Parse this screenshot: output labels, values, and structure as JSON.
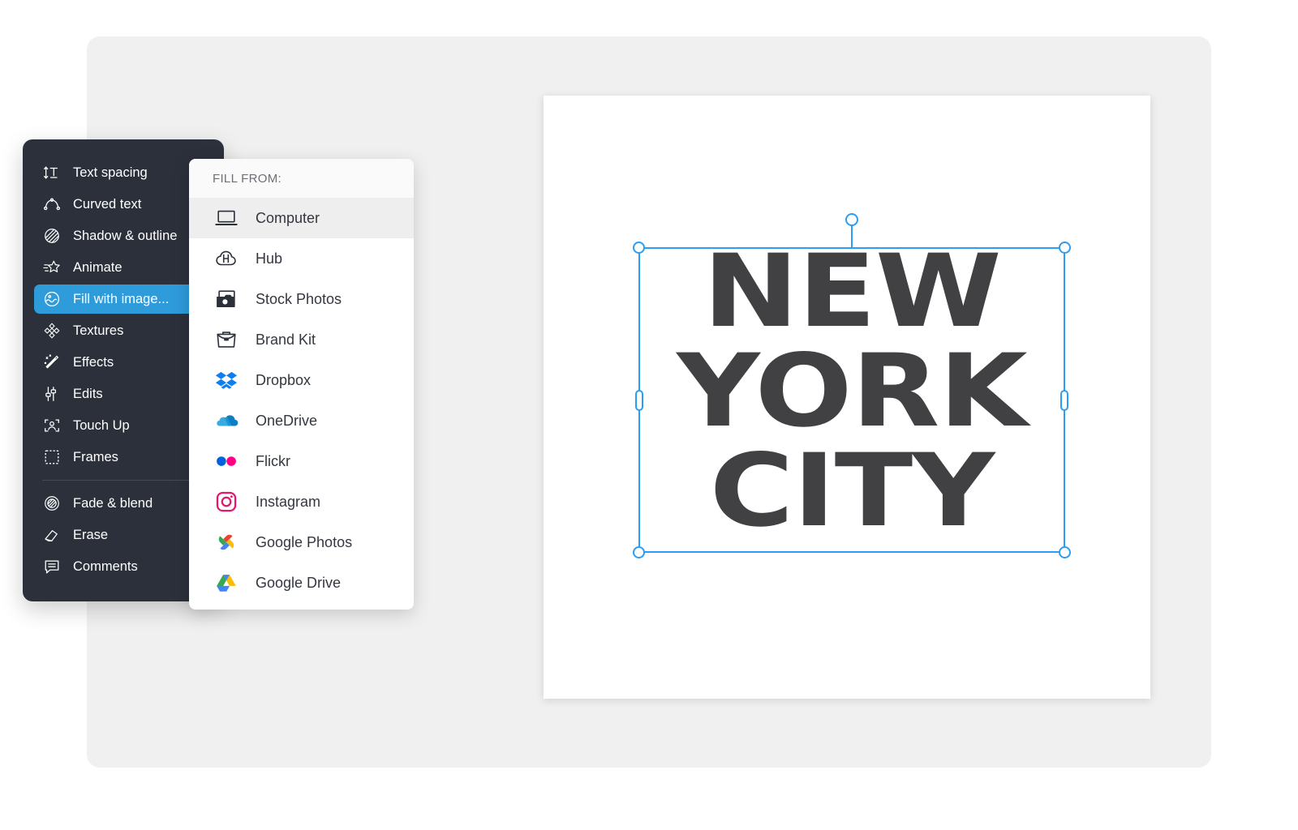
{
  "canvas": {
    "artwork_lines": [
      "NEW",
      "YORK",
      "CITY"
    ],
    "artwork_color": "#414042",
    "selection_color": "#2a9df4"
  },
  "tool_menu": {
    "items": [
      {
        "label": "Text spacing",
        "icon": "text-spacing-icon",
        "active": false
      },
      {
        "label": "Curved text",
        "icon": "curved-text-icon",
        "active": false
      },
      {
        "label": "Shadow & outline",
        "icon": "shadow-outline-icon",
        "active": false
      },
      {
        "label": "Animate",
        "icon": "animate-star-icon",
        "active": false
      },
      {
        "label": "Fill with image...",
        "icon": "fill-with-image-icon",
        "active": true
      },
      {
        "label": "Textures",
        "icon": "textures-icon",
        "active": false
      },
      {
        "label": "Effects",
        "icon": "effects-wand-icon",
        "active": false
      },
      {
        "label": "Edits",
        "icon": "edits-sliders-icon",
        "active": false
      },
      {
        "label": "Touch Up",
        "icon": "touch-up-face-icon",
        "active": false
      },
      {
        "label": "Frames",
        "icon": "frames-icon",
        "active": false
      },
      {
        "label": "Fade & blend",
        "icon": "fade-blend-icon",
        "active": false
      },
      {
        "label": "Erase",
        "icon": "erase-icon",
        "active": false
      },
      {
        "label": "Comments",
        "icon": "comments-icon",
        "active": false
      }
    ],
    "divider_after_index": 9,
    "background_color": "#2b303b",
    "active_color": "#2e9bda"
  },
  "fill_panel": {
    "header": "FILL FROM:",
    "items": [
      {
        "label": "Computer",
        "icon": "laptop-icon",
        "selected": true
      },
      {
        "label": "Hub",
        "icon": "hub-cloud-icon",
        "selected": false
      },
      {
        "label": "Stock Photos",
        "icon": "stock-photos-icon",
        "selected": false
      },
      {
        "label": "Brand Kit",
        "icon": "briefcase-icon",
        "selected": false
      },
      {
        "label": "Dropbox",
        "icon": "dropbox-icon",
        "selected": false
      },
      {
        "label": "OneDrive",
        "icon": "onedrive-icon",
        "selected": false
      },
      {
        "label": "Flickr",
        "icon": "flickr-icon",
        "selected": false
      },
      {
        "label": "Instagram",
        "icon": "instagram-icon",
        "selected": false
      },
      {
        "label": "Google Photos",
        "icon": "google-photos-icon",
        "selected": false
      },
      {
        "label": "Google Drive",
        "icon": "google-drive-icon",
        "selected": false
      }
    ],
    "brand_colors": {
      "dropbox": "#0f7ff0",
      "onedrive": "#1a96d8",
      "flickr_blue": "#0063dc",
      "flickr_pink": "#ff0084",
      "instagram": "#e8156c",
      "google_red": "#ea4335",
      "google_yellow": "#fbbc04",
      "google_green": "#34a853",
      "google_blue": "#4285f4"
    }
  }
}
